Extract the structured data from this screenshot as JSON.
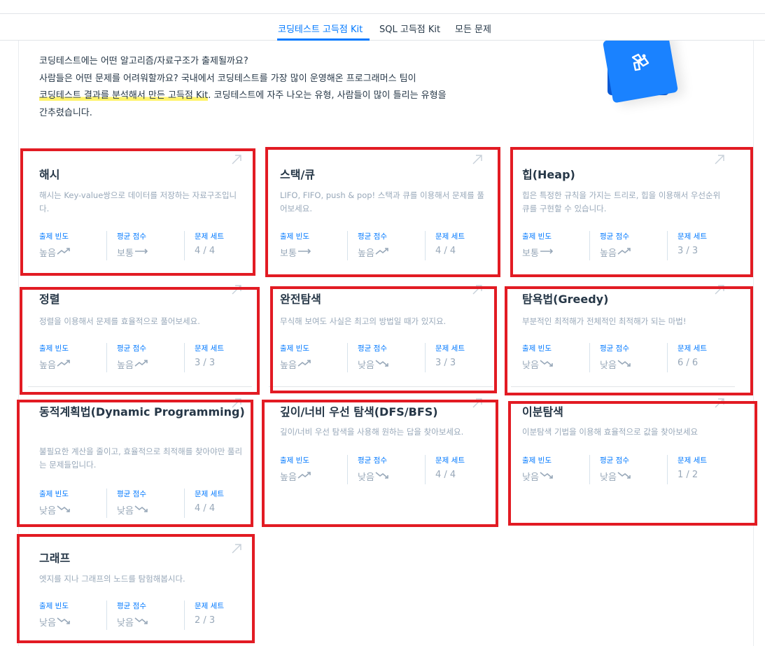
{
  "tabs": [
    {
      "label": "코딩테스트 고득점 Kit",
      "active": true
    },
    {
      "label": "SQL 고득점 Kit",
      "active": false
    },
    {
      "label": "모든 문제",
      "active": false
    }
  ],
  "intro": {
    "line1": "코딩테스트에는 어떤 알고리즘/자료구조가 출제될까요?",
    "line2": "사람들은 어떤 문제를 어려워할까요? 국내에서 코딩테스트를 가장 많이 운영해온 프로그래머스 팀이",
    "line3_highlight": "코딩테스트 결과를 분석해서 만든 고득점 Kit",
    "line3_rest": ". 코딩테스트에 자주 나오는 유형, 사람들이 많이 틀리는 유형을",
    "line4": "간추렸습니다."
  },
  "stat_labels": {
    "frequency": "출제 빈도",
    "score": "평균 점수",
    "set": "문제 세트"
  },
  "colors": {
    "accent": "#0078ff",
    "highlight": "#fff36b",
    "annotation_box": "#e21b23"
  },
  "cards": [
    {
      "title": "해시",
      "desc": "해시는 Key-value쌍으로 데이터를 저장하는 자료구조입니다.",
      "frequency": "높음",
      "frequency_trend": "up",
      "score": "보통",
      "score_trend": "flat",
      "set": "4 / 4"
    },
    {
      "title": "스택/큐",
      "desc": "LIFO, FIFO, push & pop! 스택과 큐를 이용해서 문제를 풀어보세요.",
      "frequency": "보통",
      "frequency_trend": "flat",
      "score": "높음",
      "score_trend": "up",
      "set": "4 / 4"
    },
    {
      "title": "힙(Heap)",
      "desc": "힙은 특정한 규칙을 가지는 트리로, 힙을 이용해서 우선순위 큐를 구현할 수 있습니다.",
      "frequency": "보통",
      "frequency_trend": "flat",
      "score": "높음",
      "score_trend": "up",
      "set": "3 / 3"
    },
    {
      "title": "정렬",
      "desc": "정렬을 이용해서 문제를 효율적으로 풀어보세요.",
      "frequency": "높음",
      "frequency_trend": "up",
      "score": "높음",
      "score_trend": "up",
      "set": "3 / 3"
    },
    {
      "title": "완전탐색",
      "desc": "무식해 보여도 사실은 최고의 방법일 때가 있지요.",
      "frequency": "높음",
      "frequency_trend": "up",
      "score": "낮음",
      "score_trend": "down",
      "set": "3 / 3"
    },
    {
      "title": "탐욕법(Greedy)",
      "desc": "부분적인 최적해가 전체적인 최적해가 되는 마법!",
      "frequency": "낮음",
      "frequency_trend": "down",
      "score": "낮음",
      "score_trend": "down",
      "set": "6 / 6"
    },
    {
      "title": "동적계획법(Dynamic Programming)",
      "desc": "불필요한 계산을 줄이고, 효율적으로 최적해를 찾아야만 풀리는 문제들입니다.",
      "frequency": "낮음",
      "frequency_trend": "down",
      "score": "낮음",
      "score_trend": "down",
      "set": "4 / 4"
    },
    {
      "title": "깊이/너비 우선 탐색(DFS/BFS)",
      "desc": "깊이/너비 우선 탐색을 사용해 원하는 답을 찾아보세요.",
      "frequency": "높음",
      "frequency_trend": "up",
      "score": "낮음",
      "score_trend": "down",
      "set": "4 / 4"
    },
    {
      "title": "이분탐색",
      "desc": "이분탐색 기법을 이용해 효율적으로 값을 찾아보세요",
      "frequency": "낮음",
      "frequency_trend": "down",
      "score": "낮음",
      "score_trend": "down",
      "set": "1 / 2"
    },
    {
      "title": "그래프",
      "desc": "엣지를 지나 그래프의 노드를 탐험해봅시다.",
      "frequency": "낮음",
      "frequency_trend": "down",
      "score": "낮음",
      "score_trend": "down",
      "set": "2 / 3"
    }
  ]
}
